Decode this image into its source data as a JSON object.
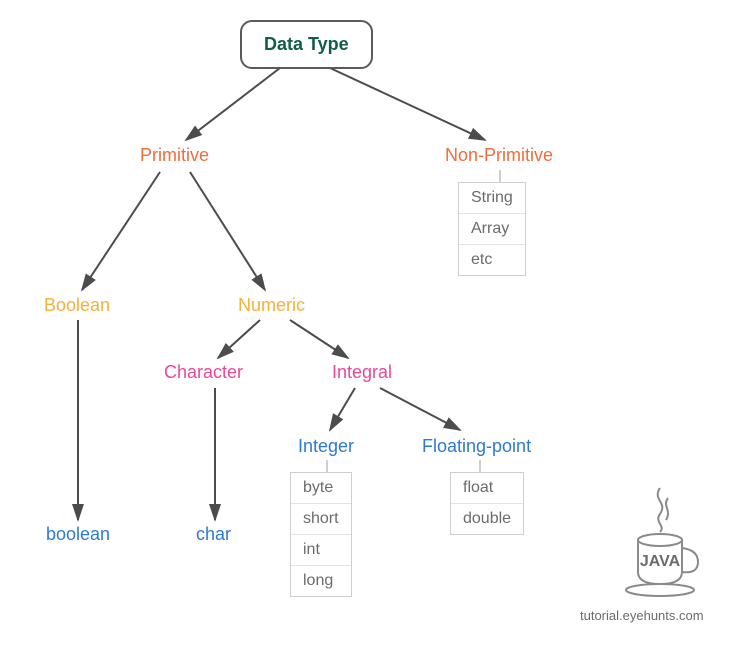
{
  "chart_data": {
    "type": "tree",
    "title": "Data Type",
    "root": "Data Type",
    "children": [
      {
        "label": "Primitive",
        "children": [
          {
            "label": "Boolean",
            "children": [
              {
                "label": "boolean"
              }
            ]
          },
          {
            "label": "Numeric",
            "children": [
              {
                "label": "Character",
                "children": [
                  {
                    "label": "char"
                  }
                ]
              },
              {
                "label": "Integral",
                "children": [
                  {
                    "label": "Integer",
                    "types": [
                      "byte",
                      "short",
                      "int",
                      "long"
                    ]
                  },
                  {
                    "label": "Floating-point",
                    "types": [
                      "float",
                      "double"
                    ]
                  }
                ]
              }
            ]
          }
        ]
      },
      {
        "label": "Non-Primitive",
        "types": [
          "String",
          "Array",
          "etc"
        ]
      }
    ]
  },
  "nodes": {
    "root": "Data Type",
    "primitive": "Primitive",
    "nonprimitive": "Non-Primitive",
    "boolean_cat": "Boolean",
    "numeric": "Numeric",
    "character": "Character",
    "integral": "Integral",
    "integer": "Integer",
    "floating": "Floating-point",
    "boolean_leaf": "boolean",
    "char_leaf": "char"
  },
  "tables": {
    "nonprimitive": [
      "String",
      "Array",
      "etc"
    ],
    "integer": [
      "byte",
      "short",
      "int",
      "long"
    ],
    "floating": [
      "float",
      "double"
    ]
  },
  "logo_text": "JAVA",
  "attribution": "tutorial.eyehunts.com"
}
